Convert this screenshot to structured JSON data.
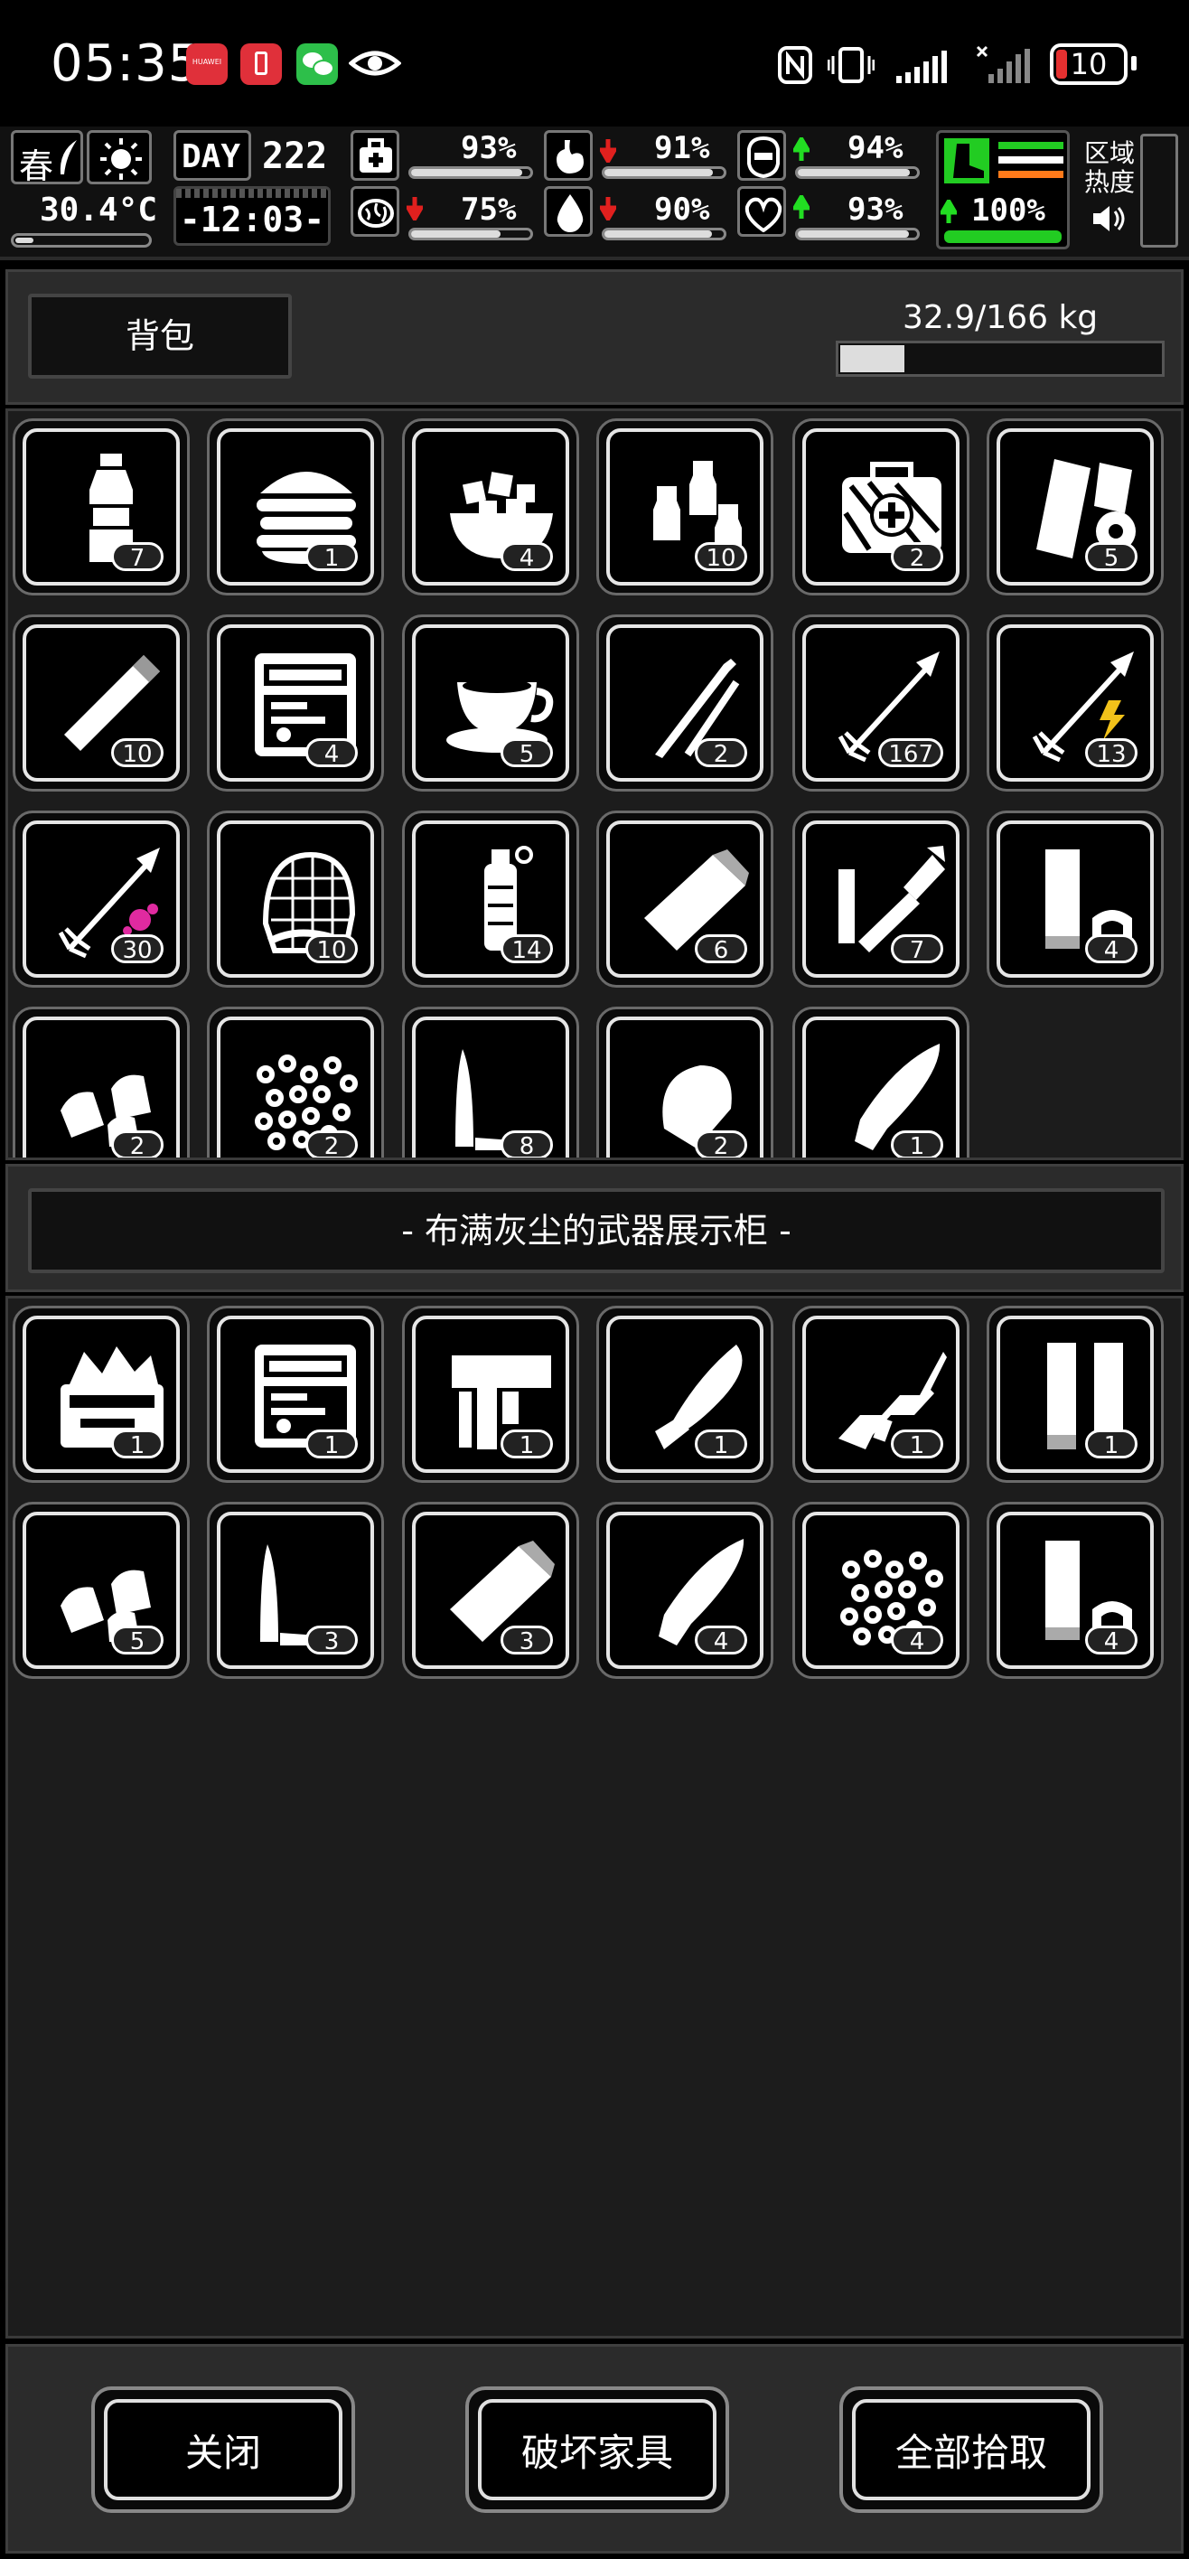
{
  "status_bar": {
    "time": "05:35",
    "app_icons": [
      "huawei-app-icon",
      "battery-alert-app-icon",
      "wechat-icon",
      "eye-icon"
    ],
    "battery": "10",
    "indicators": [
      "nfc-icon",
      "vibrate-icon",
      "signal-icon",
      "signal-icon-2"
    ]
  },
  "hud": {
    "season": "春",
    "temperature": "30.4°C",
    "day_label": "DAY",
    "day": "222",
    "clock": "-12:03-",
    "stats": [
      {
        "icon": "medkit-icon",
        "value": "93%",
        "trend": "",
        "level": 0.93
      },
      {
        "icon": "stomach-icon",
        "value": "91%",
        "trend": "down",
        "level": 0.91
      },
      {
        "icon": "shield-icon",
        "value": "94%",
        "trend": "up",
        "level": 0.94
      },
      {
        "icon": "brain-icon",
        "value": "75%",
        "trend": "down",
        "level": 0.75
      },
      {
        "icon": "water-drop-icon",
        "value": "90%",
        "trend": "down",
        "level": 0.9
      },
      {
        "icon": "heart-icon",
        "value": "93%",
        "trend": "up",
        "level": 0.93
      }
    ],
    "stamina": {
      "value": "100%",
      "trend": "up",
      "level": 1.0
    },
    "zone_heat_label_1": "区域",
    "zone_heat_label_2": "热度"
  },
  "backpack": {
    "title": "背包",
    "weight": "32.9/166 kg",
    "weight_fraction": 0.198,
    "items": [
      {
        "name": "water-bottle-icon",
        "count": "7"
      },
      {
        "name": "burger-icon",
        "count": "1"
      },
      {
        "name": "fruit-bowl-icon",
        "count": "4"
      },
      {
        "name": "potions-icon",
        "count": "10"
      },
      {
        "name": "first-aid-kit-icon",
        "count": "2"
      },
      {
        "name": "bandage-roll-icon",
        "count": "5"
      },
      {
        "name": "cigarette-icon",
        "count": "10"
      },
      {
        "name": "toolbox-icon",
        "count": "4"
      },
      {
        "name": "coffee-cup-icon",
        "count": "5"
      },
      {
        "name": "lockpick-icon",
        "count": "2"
      },
      {
        "name": "arrow-icon",
        "count": "167"
      },
      {
        "name": "electric-arrow-icon",
        "count": "13"
      },
      {
        "name": "poison-arrow-icon",
        "count": "30"
      },
      {
        "name": "net-icon",
        "count": "10"
      },
      {
        "name": "grenade-icon",
        "count": "14"
      },
      {
        "name": "shell-icon",
        "count": "6"
      },
      {
        "name": "launcher-ammo-icon",
        "count": "7"
      },
      {
        "name": "shotgun-shell-icon",
        "count": "4"
      },
      {
        "name": "pistol-ammo-icon",
        "count": "2"
      },
      {
        "name": "pellets-icon",
        "count": "2"
      },
      {
        "name": "rifle-round-icon",
        "count": "8"
      },
      {
        "name": "bullet-tip-icon",
        "count": "2"
      },
      {
        "name": "long-bullet-icon",
        "count": "1"
      }
    ]
  },
  "container": {
    "title": "- 布满灰尘的武器展示柜 -",
    "items": [
      {
        "name": "tool-chest-icon",
        "count": "1"
      },
      {
        "name": "toolbox-icon",
        "count": "1"
      },
      {
        "name": "nail-gun-icon",
        "count": "1"
      },
      {
        "name": "machete-icon",
        "count": "1"
      },
      {
        "name": "assault-rifle-icon",
        "count": "1"
      },
      {
        "name": "cartridges-icon",
        "count": "1"
      },
      {
        "name": "pistol-ammo-icon",
        "count": "5"
      },
      {
        "name": "rifle-round-icon",
        "count": "3"
      },
      {
        "name": "shell-icon",
        "count": "3"
      },
      {
        "name": "long-bullet-icon",
        "count": "4"
      },
      {
        "name": "pellets-icon",
        "count": "4"
      },
      {
        "name": "shotgun-shell-icon",
        "count": "4"
      }
    ]
  },
  "buttons": {
    "close": "关闭",
    "destroy": "破坏家具",
    "take_all": "全部拾取"
  }
}
